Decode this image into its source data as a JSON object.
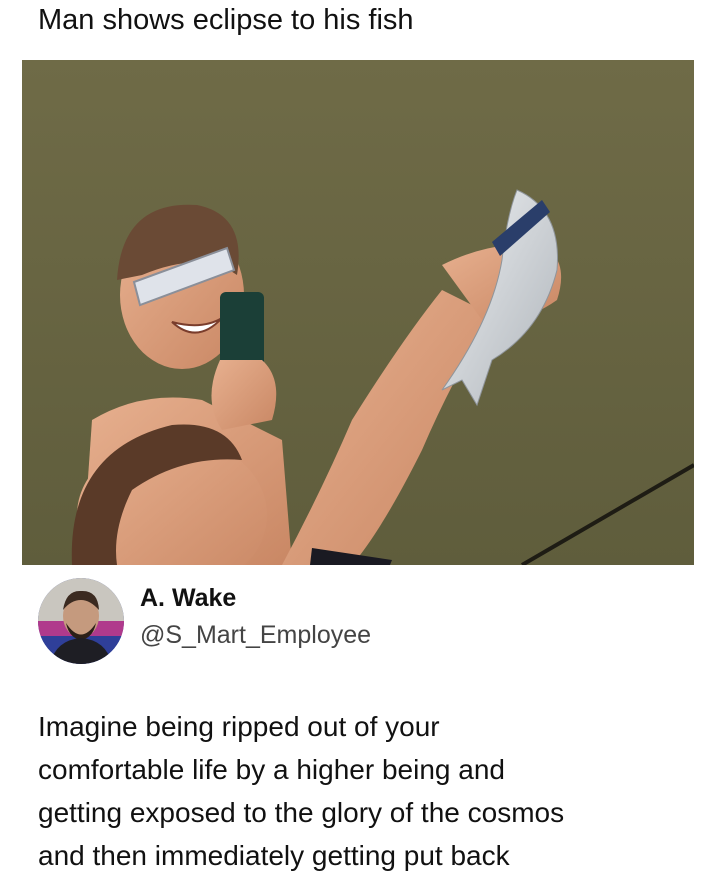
{
  "caption": "Man shows eclipse to his fish",
  "photo": {
    "subject_icon": "photo-men-holding-fish"
  },
  "post": {
    "display_name": "A. Wake",
    "handle": "@S_Mart_Employee",
    "avatar_icon": "avatar-photo",
    "text_lines": [
      "Imagine being ripped out of your",
      "comfortable life by a higher being and",
      "getting exposed to the glory of the cosmos",
      "and then immediately getting put back"
    ]
  }
}
